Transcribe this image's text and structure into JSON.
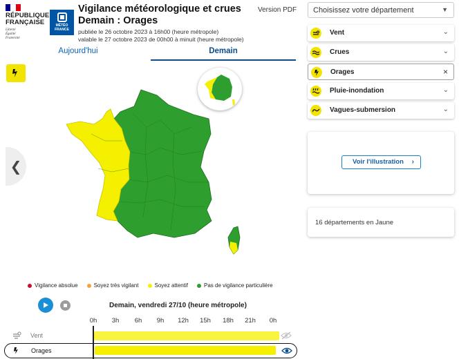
{
  "header": {
    "republic_lines": [
      "RÉPUBLIQUE",
      "FRANÇAISE"
    ],
    "motto_lines": [
      "Liberté",
      "Égalité",
      "Fraternité"
    ],
    "meteo_lines": [
      "MÉTÉO",
      "FRANCE"
    ],
    "title_line1": "Vigilance météorologique et crues",
    "title_line2": "Demain : Orages",
    "published": "publiée le 26 octobre 2023 à 16h00 (heure métropole)",
    "valid": "valable le 27 octobre 2023 de 00h00 à minuit (heure métropole)",
    "pdf_link": "Version PDF"
  },
  "tabs": [
    {
      "label": "Aujourd'hui",
      "active": false
    },
    {
      "label": "Demain",
      "active": true
    }
  ],
  "map": {
    "hazard_icon": "thunderstorm-icon",
    "green": "#2e9f2e",
    "yellow": "#f5f000",
    "inset_yellow": "#f5f000",
    "inset_green": "#2e9f2e"
  },
  "legend": [
    {
      "label": "Vigilance absolue",
      "color": "#c8102e"
    },
    {
      "label": "Soyez très vigilant",
      "color": "#f2a33a"
    },
    {
      "label": "Soyez attentif",
      "color": "#f5f000"
    },
    {
      "label": "Pas de vigilance particulière",
      "color": "#2e9f2e"
    }
  ],
  "timeline": {
    "title": "Demain, vendredi 27/10 (heure métropole)",
    "hours": [
      "0h",
      "3h",
      "6h",
      "9h",
      "12h",
      "15h",
      "18h",
      "21h",
      "0h"
    ],
    "rows": [
      {
        "label": "Vent",
        "icon": "wind-icon",
        "level": "yellow",
        "visible": false
      },
      {
        "label": "Orages",
        "icon": "thunderstorm-icon",
        "level": "yellow",
        "visible": true
      }
    ]
  },
  "panel": {
    "department_placeholder": "Choisissez votre département",
    "hazards": [
      {
        "label": "Vent",
        "icon": "wind-icon",
        "selected": false
      },
      {
        "label": "Crues",
        "icon": "flood-icon",
        "selected": false
      },
      {
        "label": "Orages",
        "icon": "thunderstorm-icon",
        "selected": true
      },
      {
        "label": "Pluie-inondation",
        "icon": "rain-flood-icon",
        "selected": false
      },
      {
        "label": "Vagues-submersion",
        "icon": "waves-icon",
        "selected": false
      }
    ],
    "illustration_button": "Voir l'illustration",
    "count_text": "16 départements en Jaune"
  }
}
